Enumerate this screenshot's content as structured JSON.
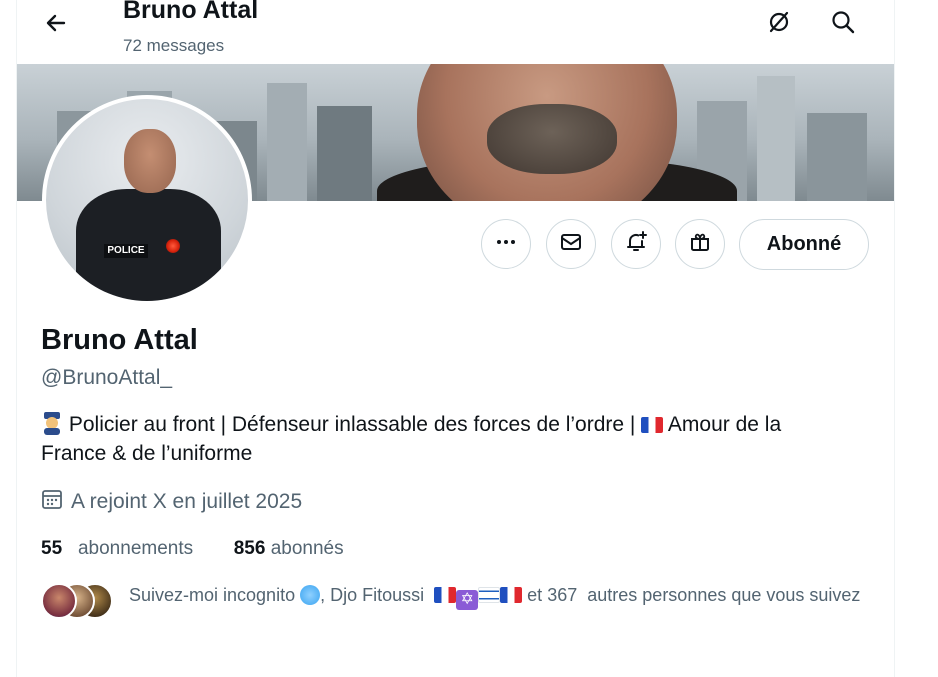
{
  "header": {
    "title": "Bruno Attal",
    "subtitle": "72 messages"
  },
  "icons": {
    "back": "arrow-left-icon",
    "grok": "grok-icon",
    "search": "search-icon",
    "more": "more-dots-icon",
    "message": "envelope-icon",
    "notify": "bell-plus-icon",
    "gift": "gift-icon",
    "calendar": "calendar-icon"
  },
  "profile": {
    "name": "Bruno Attal",
    "handle": "@BrunoAttal_",
    "bio_line1": "Policier au front | Défenseur inlassable des forces de l’ordre | ",
    "bio_line1_end": " Amour de la",
    "bio_line2": "France & de l’uniforme",
    "joined": "A rejoint X en juillet 2025"
  },
  "actions": {
    "follow_label": "Abonné"
  },
  "stats": {
    "following_count": "55",
    "following_label": "abonnements",
    "followers_count": "856",
    "followers_label": "abonnés"
  },
  "followed_by": {
    "name1": "Suivez-moi  incognito",
    "name2": "Djo Fitoussi",
    "and": "et",
    "count": "367",
    "rest": "autres personnes que vous suivez"
  },
  "colors": {
    "text": "#0f1419",
    "secondary": "#536471",
    "border": "#cfd9de"
  }
}
